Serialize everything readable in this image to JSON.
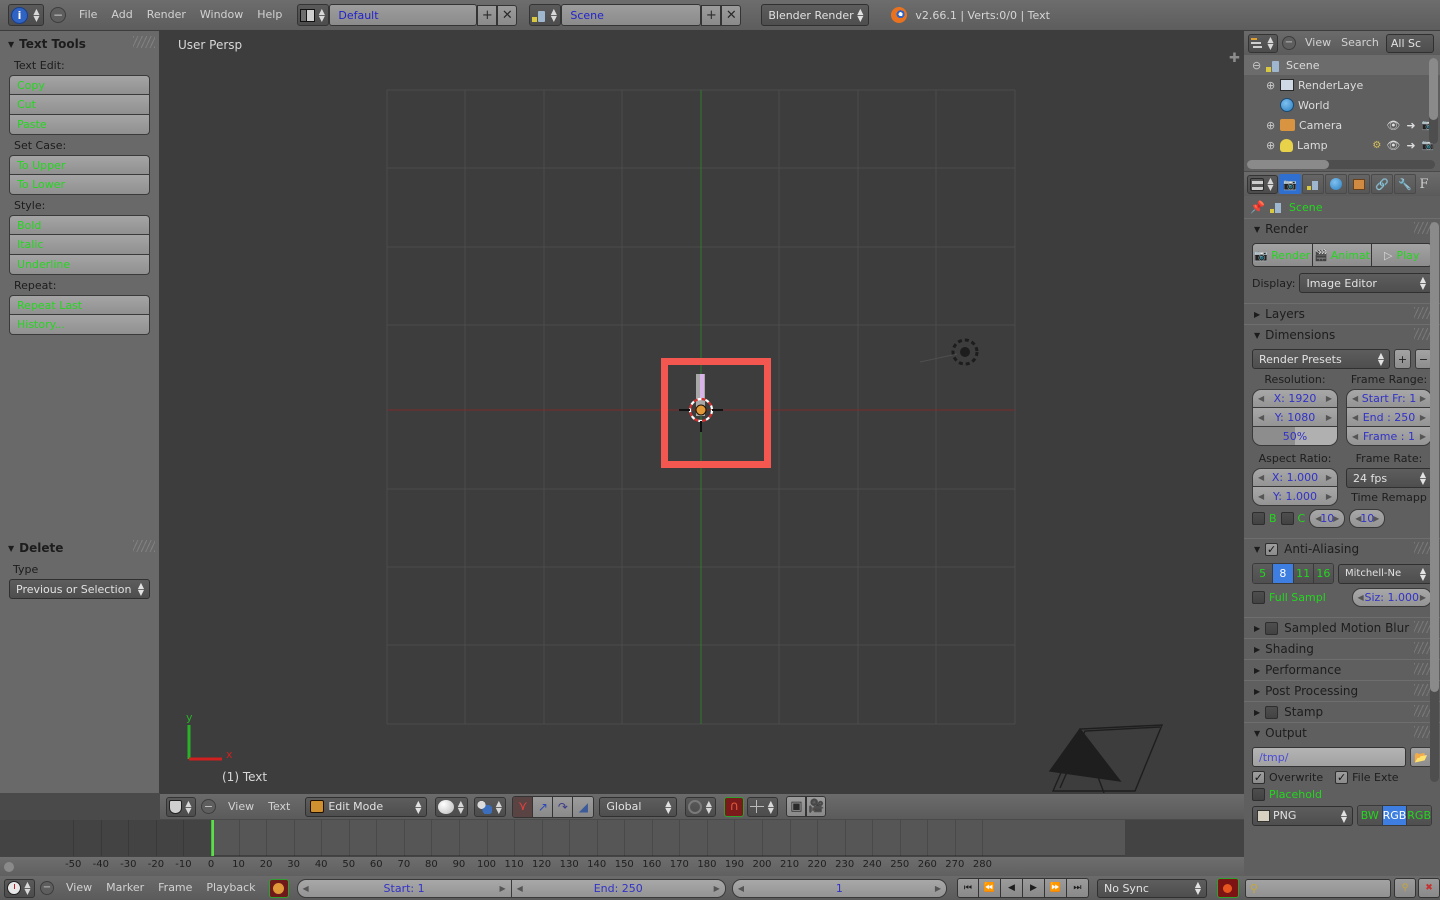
{
  "app": {
    "version_status": "v2.66.1 | Verts:0/0 | Text",
    "engine": "Blender Render",
    "screen_layout": "Default",
    "scene_name": "Scene"
  },
  "topbar": {
    "menus": [
      "File",
      "Add",
      "Render",
      "Window",
      "Help"
    ],
    "info_icon": "info-editor-icon",
    "collapse_icon": "collapse-menu-icon",
    "layout_icon": "screen-layout-icon",
    "scene_icon": "scene-datablock-icon",
    "engine_icon": "blender-logo-icon",
    "add_label": "+",
    "remove_label": "✕"
  },
  "toolshelf": {
    "panels": [
      {
        "title": "Text Tools",
        "open": true,
        "groups": [
          {
            "label": "Text Edit:",
            "buttons": [
              "Copy",
              "Cut",
              "Paste"
            ]
          },
          {
            "label": "Set Case:",
            "buttons": [
              "To Upper",
              "To Lower"
            ]
          },
          {
            "label": "Style:",
            "buttons": [
              "Bold",
              "Italic",
              "Underline"
            ]
          },
          {
            "label": "Repeat:",
            "buttons": [
              "Repeat Last",
              "History..."
            ]
          }
        ]
      },
      {
        "title": "Delete",
        "open": true,
        "type_label": "Type",
        "type_value": "Previous or Selection"
      }
    ]
  },
  "viewport": {
    "view_label": "User Persp",
    "object_label": "(1) Text",
    "axis_x": "x",
    "axis_y": "y",
    "header": {
      "editor_icon": "editor-type-3dview-icon",
      "collapse_icon": "collapse-menu-icon",
      "menus": [
        "View",
        "Text"
      ],
      "mode": "Edit Mode",
      "shading": "solid-shading-icon",
      "pivot": "pivot-median-icon",
      "manip_move": "manipulator-translate-icon",
      "manip_rotate": "manipulator-rotate-icon",
      "manip_scale": "manipulator-scale-icon",
      "orientation": "Global",
      "snap_magnet": "snap-magnet-icon",
      "snap_target": "snap-target-icon",
      "render_icon": "render-opengl-icon",
      "anim_icon": "render-animation-icon",
      "layer_icon": "proportional-edit-icon"
    }
  },
  "outliner": {
    "header": {
      "editor_icon": "editor-type-outliner-icon",
      "collapse_icon": "collapse-menu-icon",
      "menus": [
        "View",
        "Search"
      ],
      "display_mode": "All Sc"
    },
    "rows": [
      {
        "label": "Scene",
        "icon": "scene-icon",
        "indent": 0,
        "expander": "⊖"
      },
      {
        "label": "RenderLaye",
        "icon": "renderlayers-icon",
        "indent": 1,
        "expander": "⊕"
      },
      {
        "label": "World",
        "icon": "world-icon",
        "indent": 1,
        "expander": ""
      },
      {
        "label": "Camera",
        "icon": "camera-icon",
        "indent": 1,
        "expander": "⊕"
      },
      {
        "label": "Lamp",
        "icon": "lamp-icon",
        "indent": 1,
        "expander": "⊕"
      }
    ]
  },
  "properties": {
    "tabs": [
      "render-tab-icon",
      "scene-tab-icon",
      "world-tab-icon",
      "object-tab-icon",
      "constraint-tab-icon",
      "modifier-tab-icon",
      "font-tab-icon"
    ],
    "active_tab_index": 0,
    "breadcrumb": {
      "pin_icon": "pin-icon",
      "icon": "scene-icon",
      "label": "Scene"
    },
    "render": {
      "title": "Render",
      "open": true,
      "buttons": [
        "Render",
        "Animat",
        "Play"
      ],
      "display_label": "Display:",
      "display_value": "Image Editor"
    },
    "layers": {
      "title": "Layers",
      "open": false
    },
    "dimensions": {
      "title": "Dimensions",
      "open": true,
      "preset": "Render Presets",
      "preset_add": "+",
      "preset_remove": "−",
      "resolution_label": "Resolution:",
      "res_x": "X: 1920",
      "res_y": "Y: 1080",
      "res_percent": "50%",
      "frame_range_label": "Frame Range:",
      "frame_start": "Start Fr: 1",
      "frame_end": "End : 250",
      "frame_current": "Frame : 1",
      "aspect_label": "Aspect Ratio:",
      "aspect_x": "X: 1.000",
      "aspect_y": "Y: 1.000",
      "framerate_label": "Frame Rate:",
      "framerate": "24 fps",
      "time_remap_label": "Time Remapp",
      "remap_old": "10",
      "remap_new": "10",
      "border_b": "B",
      "border_c": "C"
    },
    "antialiasing": {
      "title": "Anti-Aliasing",
      "open": true,
      "checked": true,
      "samples": [
        "5",
        "8",
        "11",
        "16"
      ],
      "samples_active": "8",
      "filter": "Mitchell-Ne",
      "full_sample_label": "Full Sampl",
      "full_sample_on": false,
      "size": "Siz: 1.000"
    },
    "collapsed_panels": [
      {
        "title": "Sampled Motion Blur",
        "checkbox": true
      },
      {
        "title": "Shading",
        "checkbox": false
      },
      {
        "title": "Performance",
        "checkbox": false
      },
      {
        "title": "Post Processing",
        "checkbox": false
      },
      {
        "title": "Stamp",
        "checkbox": true
      }
    ],
    "output": {
      "title": "Output",
      "open": true,
      "path": "/tmp/",
      "folder_icon": "folder-browse-icon",
      "overwrite_label": "Overwrite",
      "overwrite_on": true,
      "file_ext_label": "File Exte",
      "file_ext_on": true,
      "placeholder_label": "Placehold",
      "placeholder_on": false,
      "format": "PNG",
      "format_icon": "image-file-icon",
      "color_modes": [
        "BW",
        "RGB",
        "RGB"
      ],
      "color_mode_active": "RGB"
    }
  },
  "timeline": {
    "ticks": [
      "-50",
      "-40",
      "-30",
      "-20",
      "-10",
      "0",
      "10",
      "20",
      "30",
      "40",
      "50",
      "60",
      "70",
      "80",
      "90",
      "100",
      "110",
      "120",
      "130",
      "140",
      "150",
      "160",
      "170",
      "180",
      "190",
      "200",
      "210",
      "220",
      "230",
      "240",
      "250",
      "260",
      "270",
      "280"
    ],
    "playhead_frame": 1,
    "range_start": 1,
    "range_end": 250,
    "header": {
      "editor_icon": "editor-type-timeline-icon",
      "collapse_icon": "collapse-menu-icon",
      "menus": [
        "View",
        "Marker",
        "Frame",
        "Playback"
      ],
      "scene_lock_icon": "scene-range-lock-icon",
      "start_label": "Start: 1",
      "end_label": "End: 250",
      "current_frame": "1",
      "nav": [
        "jump-start-icon",
        "prev-keyframe-icon",
        "play-reverse-icon",
        "play-icon",
        "next-keyframe-icon",
        "jump-end-icon"
      ],
      "sync_mode": "No Sync",
      "record_icon": "record-icon",
      "keying_set_icon": "keyingset-icon",
      "keying_set_value": "",
      "insert_key_icon": "insert-keyframe-icon",
      "delete_key_icon": "delete-keyframe-icon"
    }
  },
  "colors": {
    "accent_blue": "#3d7ee0",
    "green_text": "#23d71e",
    "value_blue": "#3232c8",
    "annotation_red": "#f4574f",
    "header_gray": "#5d5d5d",
    "panel_gray": "#696969",
    "viewport_bg": "#3d3d3d"
  }
}
